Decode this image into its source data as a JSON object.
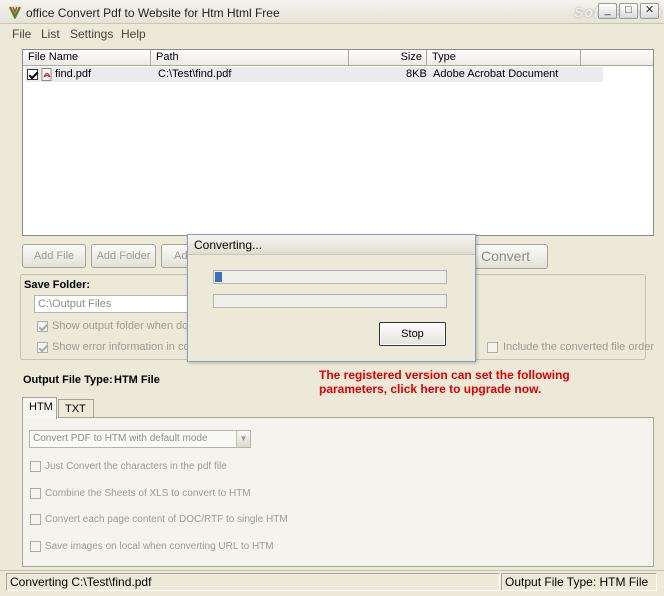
{
  "window": {
    "title": "office Convert Pdf to Website for Htm Html Free",
    "watermark": "SoftTB.com",
    "controls": {
      "minimize": "_",
      "maximize": "□",
      "close": "✕"
    }
  },
  "menu": [
    "File",
    "List",
    "Settings",
    "Help"
  ],
  "file_list": {
    "columns": [
      "File Name",
      "Path",
      "Size",
      "Type"
    ],
    "rows": [
      {
        "checked": true,
        "name": "find.pdf",
        "path": "C:\\Test\\find.pdf",
        "size": "8KB",
        "type": "Adobe Acrobat Document",
        "icon": "pdf-file-icon"
      }
    ]
  },
  "buttons": {
    "add_file": "Add File",
    "add_folder": "Add Folder",
    "add_partial": "Ad",
    "convert": "Convert"
  },
  "save_folder": {
    "label": "Save Folder:",
    "value": "C:\\Output Files",
    "show_output": "Show output folder when done",
    "show_error": "Show error information in convers",
    "include_converted": "Include the converted file order"
  },
  "output_type": {
    "label": "Output File Type:",
    "value": "HTM File"
  },
  "upgrade_notice": {
    "line1": "The registered version can set the following",
    "line2": "parameters, click here to upgrade now."
  },
  "tabs": [
    "HTM",
    "TXT"
  ],
  "htm_options": {
    "mode": "Convert PDF to HTM with default mode",
    "opt1": "Just Convert the characters in the pdf file",
    "opt2": "Combine the Sheets of XLS to convert to HTM",
    "opt3": "Convert each page content of DOC/RTF to single HTM",
    "opt4": "Save images on local when converting URL to HTM"
  },
  "status": {
    "left": "Converting  C:\\Test\\find.pdf",
    "right": "Output File Type:  HTM File"
  },
  "dialog": {
    "title": "Converting...",
    "progress1": 0.03,
    "progress2": 0,
    "stop": "Stop"
  }
}
